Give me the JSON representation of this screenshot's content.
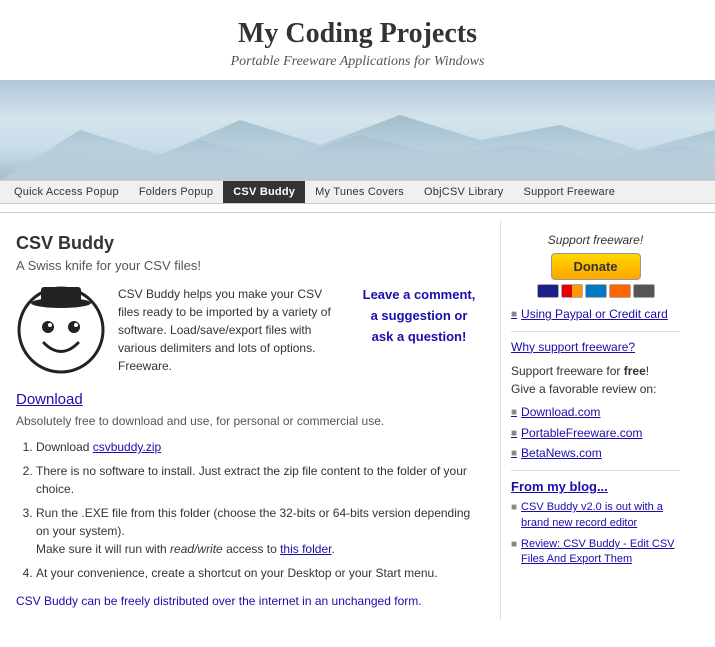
{
  "header": {
    "title": "My Coding Projects",
    "subtitle": "Portable Freeware Applications for Windows"
  },
  "nav": {
    "items": [
      {
        "label": "Quick Access Popup",
        "active": false
      },
      {
        "label": "Folders Popup",
        "active": false
      },
      {
        "label": "CSV Buddy",
        "active": true
      },
      {
        "label": "My Tunes Covers",
        "active": false
      },
      {
        "label": "ObjCSV Library",
        "active": false
      },
      {
        "label": "Support Freeware",
        "active": false
      }
    ]
  },
  "main": {
    "page_title": "CSV Buddy",
    "page_subtitle": "A Swiss knife for your CSV files!",
    "intro_text": "CSV Buddy helps you make your CSV files ready to be imported by a variety of software. Load/save/export files with various delimiters and lots of options. Freeware.",
    "comment_box": {
      "line1": "Leave a comment,",
      "line2": "a suggestion or",
      "line3": "ask a question!"
    },
    "download_label": "Download",
    "free_text": "Absolutely free to download and use, for personal or commercial use.",
    "instructions": [
      {
        "text": "Download ",
        "link": "csvbuddy.zip",
        "rest": ""
      },
      {
        "text": "There is no software to install. Just extract the zip file content to the folder of your choice.",
        "link": "",
        "rest": ""
      },
      {
        "text": "Run the .EXE file from this folder (choose the 32-bits or 64-bits version depending on your system).",
        "link": "",
        "rest": "",
        "note": "Make sure it will run with read/write access to this folder."
      },
      {
        "text": "At your convenience, create a shortcut on your Desktop or your Start menu.",
        "link": "",
        "rest": ""
      }
    ],
    "distributed_text": "CSV Buddy can be freely distributed over the internet in an unchanged form."
  },
  "sidebar": {
    "support_label": "Support freeware!",
    "donate_label": "Donate",
    "links": [
      {
        "text": "Using Paypal or Credit card"
      },
      {
        "text": "Why support freeware?"
      }
    ],
    "support_text_line1": "Support freeware for ",
    "support_text_free": "free",
    "support_text_line2": "!",
    "support_text_line3": "Give a favorable review on:",
    "review_sites": [
      {
        "label": "Download.com"
      },
      {
        "label": "PortableFreeware.com"
      },
      {
        "label": "BetaNews.com"
      }
    ],
    "blog_title": "From my blog...",
    "blog_posts": [
      {
        "text": "CSV Buddy v2.0 is out with a brand new record editor"
      },
      {
        "text": "Review: CSV Buddy - Edit CSV Files And Export Them"
      }
    ]
  }
}
